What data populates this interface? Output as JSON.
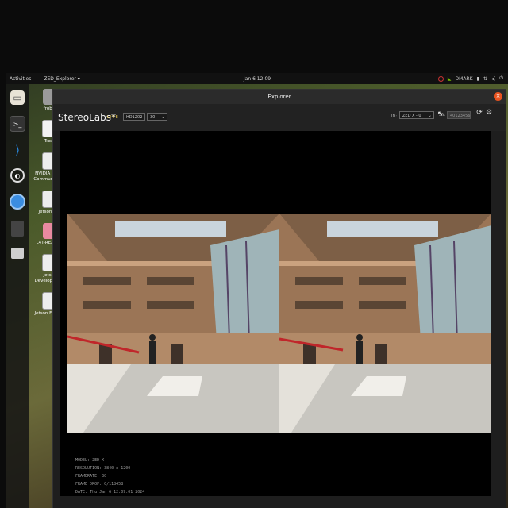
{
  "topbar": {
    "activities": "Activities",
    "app_menu": "ZED_Explorer ▾",
    "clock": "Jan 6  12:09",
    "tray_user": "DMARK"
  },
  "dock": {
    "items": [
      "files-icon",
      "terminal-icon",
      "vscode-icon",
      "obs-icon",
      "chromium-icon",
      "blank-icon",
      "drive-icon"
    ]
  },
  "desktop": {
    "items": [
      {
        "label": "frobot"
      },
      {
        "label": "Trash"
      },
      {
        "label": "NVIDIA Jetson Community P..."
      },
      {
        "label": "Jetson Zoo"
      },
      {
        "label": "L4T-README"
      },
      {
        "label": "Jetson Developer Z..."
      },
      {
        "label": "Jetson Forums"
      }
    ]
  },
  "window": {
    "title": "Explorer"
  },
  "toolbar": {
    "brand": "StereoLabs*",
    "live": "LIVE",
    "resolution": "HD1200",
    "fps": "30",
    "id_label": "ID:",
    "id_value": "ZED X - 0",
    "sn_label": "SN:",
    "sn_value": "40123456"
  },
  "info": {
    "model": "MODEL: ZED X",
    "resolution": "RESOLUTION: 3840 x 1200",
    "framerate": "FRAMERATE: 30",
    "frame_drop": "FRAME DROP: 0/118458",
    "date": "DATE: Thu Jan 6 12:09:01 2024"
  },
  "colors": {
    "accent_live": "#e6c64b",
    "close_button": "#e95420",
    "nvidia": "#76b900"
  }
}
